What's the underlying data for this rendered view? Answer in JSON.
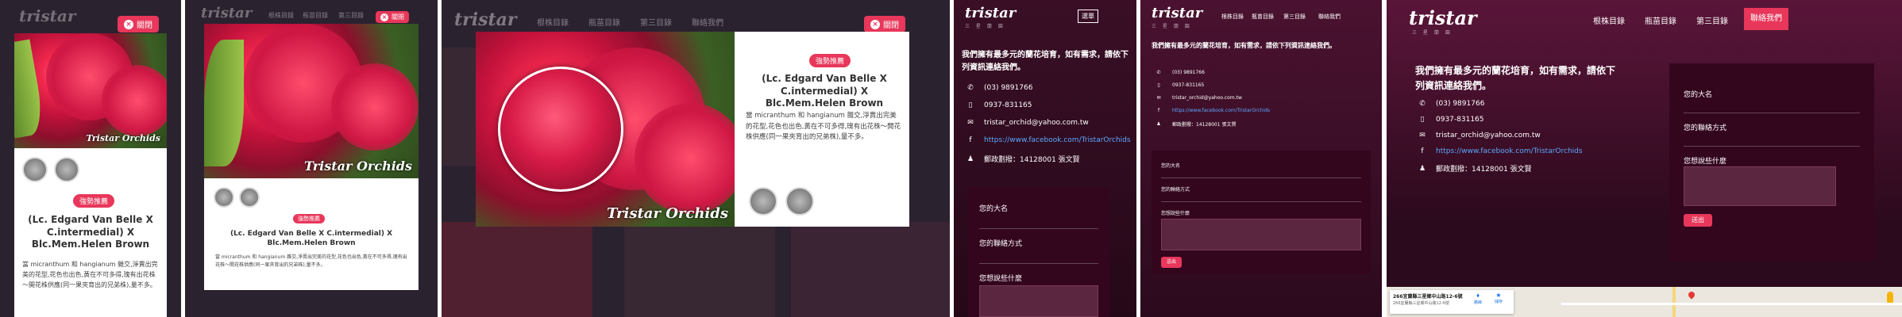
{
  "brand": {
    "name": "tristar",
    "subtitle": "三 星 蘭 園"
  },
  "close_label": "關閉",
  "menu_label": "選單",
  "nav": [
    "根株目錄",
    "瓶苗目錄",
    "第三目錄",
    "聯絡我們"
  ],
  "product": {
    "badge": "強勢推薦",
    "title": "(Lc. Edgard Van Belle X C.intermedial) X Blc.Mem.Helen Brown",
    "description": "當 micranthum 和 hangianum 雜交,淨賣出完美的花型,花色也出色,黃在不可多得,瑰有出花株～開花株供應(同一果夾育出的兄弟株),量不多。",
    "watermark": "Tristar Orchids"
  },
  "contact": {
    "heading": "我們擁有最多元的蘭花培育，如有需求，請依下列資訊連絡我們。",
    "phone": "(03) 9891766",
    "mobile": "0937-831165",
    "email": "tristar_orchid@yahoo.com.tw",
    "facebook": "https://www.facebook.com/TristarOrchids",
    "postal": "郵政劃撥：14128001 張文賢"
  },
  "form": {
    "name_label": "您的大名",
    "contact_label": "您的聯絡方式",
    "message_label": "您想說些什麼",
    "submit_label": "送出"
  },
  "map": {
    "address": "266宜蘭縣三星鄉中山路12-6號",
    "address_sub": "266宜蘭縣三星鄉中山路12-6號",
    "route_label": "路線",
    "save_label": "儲存"
  },
  "colors": {
    "accent": "#e8375a",
    "bg_dark": "#2a0a1c",
    "link": "#5ba8ff"
  }
}
